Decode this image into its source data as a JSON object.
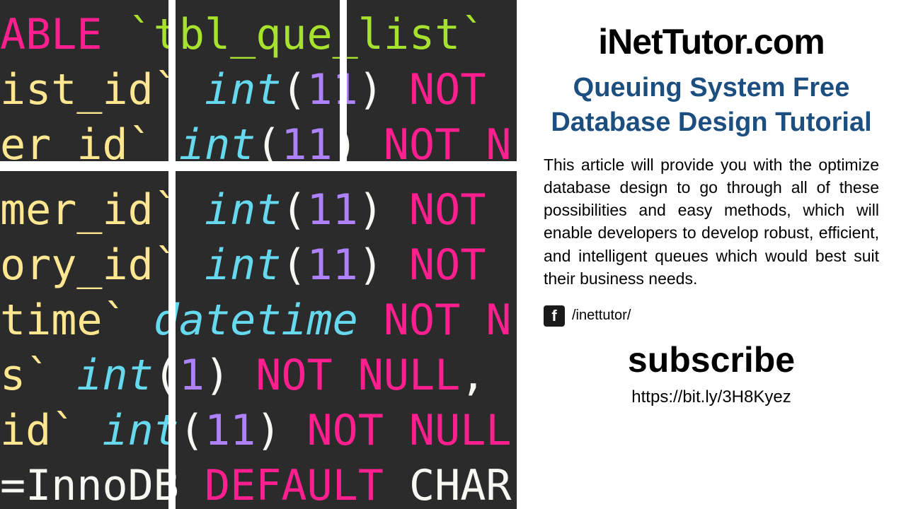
{
  "code": {
    "line1_able": "ABLE ",
    "line1_tbl": "`tbl_que_list`",
    "line2_col": "ist_id`",
    "line2_type": "int",
    "line2_paren_open": "(",
    "line2_num": "11",
    "line2_paren_close": ")",
    "line2_not": " NOT",
    "line3_col": "er_id`",
    "line3_type": "int",
    "line3_paren_open": "(",
    "line3_num": "11",
    "line3_paren_close": ")",
    "line3_not": " NOT N",
    "line4_col": "mer_id`",
    "line4_type": "int",
    "line4_paren_open": "(",
    "line4_num": "11",
    "line4_paren_close": ")",
    "line4_not": " NOT",
    "line5_col": "ory_id`",
    "line5_type": "int",
    "line5_paren_open": "(",
    "line5_num": "11",
    "line5_paren_close": ")",
    "line5_not": " NOT",
    "line6_col": "time`",
    "line6_type": "datetime",
    "line6_not": " NOT N",
    "line7_col": "s`",
    "line7_type": "int",
    "line7_paren_open": "(",
    "line7_num": "1",
    "line7_paren_close": ")",
    "line7_not": " NOT NULL",
    "line7_comma": ",",
    "line8_col": "id`",
    "line8_type": "int",
    "line8_paren_open": "(",
    "line8_num": "11",
    "line8_paren_close": ")",
    "line8_not": " NOT NULL",
    "line9_eq": "=",
    "line9_engine": "InnoDB",
    "line9_default": " DEFAULT",
    "line9_char": " CHAR"
  },
  "right": {
    "site_title": "iNetTutor.com",
    "article_title": "Queuing System Free Database Design Tutorial",
    "description": "This article will provide you with the optimize database design to go through all of these possibilities and easy methods, which will enable developers to develop robust, efficient, and intelligent queues which would best suit their business needs.",
    "fb_handle": "/inettutor/",
    "subscribe": "subscribe",
    "link": "https://bit.ly/3H8Kyez"
  }
}
